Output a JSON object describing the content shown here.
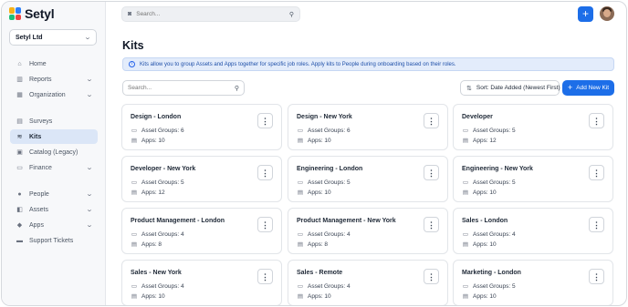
{
  "brand": {
    "name": "Setyl",
    "logo_colors": [
      "#f6b21a",
      "#2d7ff9",
      "#1fbf7a",
      "#ef4444"
    ]
  },
  "sidebar": {
    "org_name": "Setyl Ltd",
    "items": [
      {
        "label": "Home",
        "icon": "home-icon",
        "expandable": false,
        "active": false
      },
      {
        "label": "Reports",
        "icon": "bar-chart-icon",
        "expandable": true,
        "active": false
      },
      {
        "label": "Organization",
        "icon": "building-icon",
        "expandable": true,
        "active": false
      },
      {
        "label": "Surveys",
        "icon": "clipboard-icon",
        "expandable": false,
        "active": false
      },
      {
        "label": "Kits",
        "icon": "layers-icon",
        "expandable": false,
        "active": true
      },
      {
        "label": "Catalog (Legacy)",
        "icon": "catalog-icon",
        "expandable": false,
        "active": false
      },
      {
        "label": "Finance",
        "icon": "finance-icon",
        "expandable": true,
        "active": false
      },
      {
        "label": "People",
        "icon": "person-icon",
        "expandable": true,
        "active": false
      },
      {
        "label": "Assets",
        "icon": "box-icon",
        "expandable": true,
        "active": false
      },
      {
        "label": "Apps",
        "icon": "apps-icon",
        "expandable": true,
        "active": false
      },
      {
        "label": "Support Tickets",
        "icon": "ticket-icon",
        "expandable": false,
        "active": false
      }
    ]
  },
  "topbar": {
    "search_placeholder": "Search..."
  },
  "page": {
    "title": "Kits",
    "info": "Kits allow you to group Assets and Apps together for specific job roles. Apply kits to People during onboarding based on their roles.",
    "search_placeholder": "Search...",
    "sort_label": "Sort: Date Added (Newest First)",
    "add_label": "Add New Kit"
  },
  "kits": [
    {
      "name": "Design - London",
      "asset_groups": "Asset Groups: 6",
      "apps": "Apps: 10"
    },
    {
      "name": "Design - New York",
      "asset_groups": "Asset Groups: 6",
      "apps": "Apps: 10"
    },
    {
      "name": "Developer",
      "asset_groups": "Asset Groups: 5",
      "apps": "Apps: 12"
    },
    {
      "name": "Developer - New York",
      "asset_groups": "Asset Groups: 5",
      "apps": "Apps: 12"
    },
    {
      "name": "Engineering - London",
      "asset_groups": "Asset Groups: 5",
      "apps": "Apps: 10"
    },
    {
      "name": "Engineering - New York",
      "asset_groups": "Asset Groups: 5",
      "apps": "Apps: 10"
    },
    {
      "name": "Product Management - London",
      "asset_groups": "Asset Groups: 4",
      "apps": "Apps: 8"
    },
    {
      "name": "Product Management - New York",
      "asset_groups": "Asset Groups: 4",
      "apps": "Apps: 8"
    },
    {
      "name": "Sales - London",
      "asset_groups": "Asset Groups: 4",
      "apps": "Apps: 10"
    },
    {
      "name": "Sales - New York",
      "asset_groups": "Asset Groups: 4",
      "apps": "Apps: 10"
    },
    {
      "name": "Sales - Remote",
      "asset_groups": "Asset Groups: 4",
      "apps": "Apps: 10"
    },
    {
      "name": "Marketing - London",
      "asset_groups": "Asset Groups: 5",
      "apps": "Apps: 10"
    }
  ],
  "colors": {
    "accent": "#1d6ee8",
    "active_nav": "#dbe6f7",
    "info_bg": "#e3ecfb"
  }
}
